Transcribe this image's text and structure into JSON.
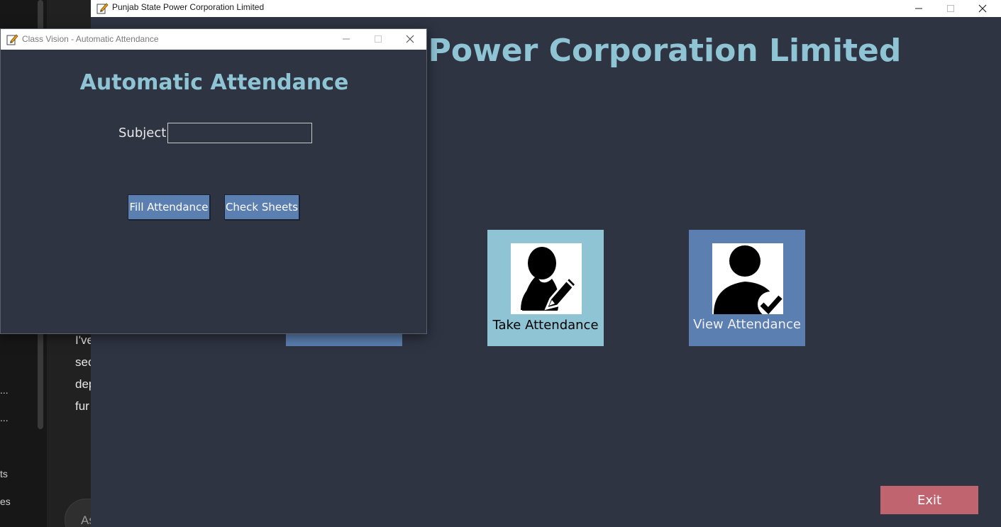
{
  "background_app": {
    "sidebar_items": [
      "...",
      "...",
      "ts",
      "es"
    ],
    "text_lines": [
      "I've",
      "sec",
      "dep",
      "fur"
    ],
    "ask_placeholder": "As"
  },
  "main_window": {
    "title": "Punjab State Power Corporation Limited",
    "heading": "Punjab State Power Corporation Limited",
    "tiles": [
      {
        "label": "Take Attendance",
        "icon": "user-edit-icon",
        "color": "#8ec4d4"
      },
      {
        "label": "View Attendance",
        "icon": "user-check-icon",
        "color": "#5b7fb0"
      }
    ],
    "exit_label": "Exit",
    "exit_color": "#c06570"
  },
  "dialog": {
    "title": "Class Vision - Automatic Attendance",
    "heading": "Automatic Attendance",
    "subject_label": "Subject:",
    "subject_value": "",
    "fill_label": "Fill Attendance",
    "check_label": "Check Sheets"
  },
  "colors": {
    "window_bg": "#2e3442",
    "heading": "#8ec4d4",
    "button": "#5b7fb0"
  }
}
